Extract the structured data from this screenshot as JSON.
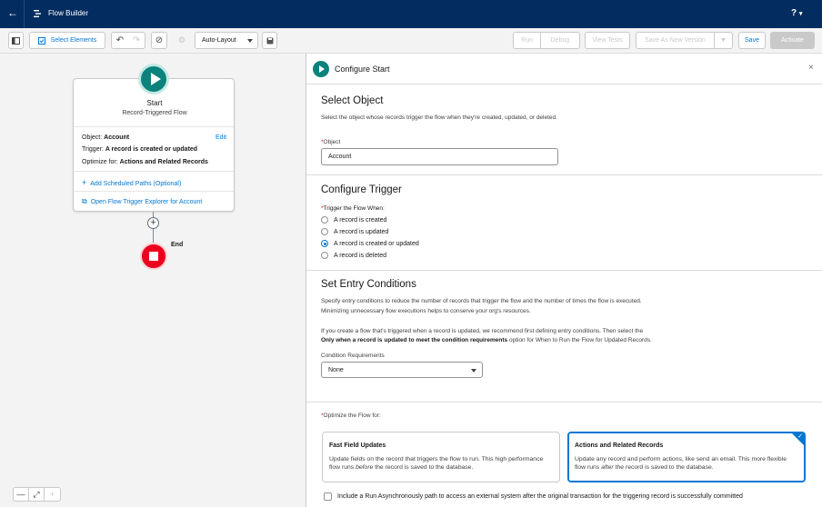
{
  "header": {
    "app_title": "Flow Builder",
    "help_label": "?",
    "back_icon": "arrow-left-icon",
    "app_icon": "flow-icon"
  },
  "toolbar": {
    "toggle_panel_icon": "panel-icon",
    "select_elements_label": "Select Elements",
    "undo_icon": "undo-icon",
    "redo_icon": "redo-icon",
    "error_icon": "prohibit-icon",
    "settings_icon": "gear-icon",
    "layout_value": "Auto-Layout",
    "save_copy_icon": "save-icon",
    "run_label": "Run",
    "debug_label": "Debug",
    "view_tests_label": "View Tests",
    "save_as_new_label": "Save As New Version",
    "save_label": "Save",
    "activate_label": "Activate"
  },
  "canvas": {
    "start_title": "Start",
    "start_subtitle": "Record-Triggered Flow",
    "object_label": "Object:",
    "object_value": "Account",
    "edit_label": "Edit",
    "trigger_label": "Trigger:",
    "trigger_value": "A record is created or updated",
    "optimize_label": "Optimize for:",
    "optimize_value": "Actions and Related Records",
    "add_paths_label": "Add Scheduled Paths (Optional)",
    "explorer_label": "Open Flow Trigger Explorer for Account",
    "end_label": "End",
    "zoom_out": "—",
    "zoom_fit": "⤢",
    "zoom_in": "+"
  },
  "panel": {
    "title": "Configure Start",
    "close_label": "×",
    "select_object": {
      "heading": "Select Object",
      "description": "Select the object whose records trigger the flow when they're created, updated, or deleted.",
      "field_label": "Object",
      "field_value": "Account"
    },
    "configure_trigger": {
      "heading": "Configure Trigger",
      "label": "Trigger the Flow When:",
      "options": [
        {
          "label": "A record is created",
          "selected": false
        },
        {
          "label": "A record is updated",
          "selected": false
        },
        {
          "label": "A record is created or updated",
          "selected": true
        },
        {
          "label": "A record is deleted",
          "selected": false
        }
      ]
    },
    "entry_conditions": {
      "heading": "Set Entry Conditions",
      "desc1_line1": "Specify entry conditions to reduce the number of records that trigger the flow and the number of times the flow is executed.",
      "desc1_line2": "Minimizing unnecessary flow executions helps to conserve your org's resources.",
      "desc2_line1": "If you create a flow that's triggered when a record is updated, we recommend first defining entry conditions. Then select the",
      "desc2_bold": "Only when a record is updated to meet the condition requirements",
      "desc2_rest": " option for When to Run the Flow for Updated Records.",
      "condition_label": "Condition Requirements",
      "condition_value": "None"
    },
    "optimize": {
      "label": "Optimize the Flow for:",
      "fast_title": "Fast Field Updates",
      "fast_desc_a": "Update fields on the record that triggers the flow to run. This high performance flow runs ",
      "fast_desc_em": "before",
      "fast_desc_b": " the record is saved to the database.",
      "actions_title": "Actions and Related Records",
      "actions_desc_a": "Update any record and perform actions, like send an email. This more flexible flow runs ",
      "actions_desc_em": "after",
      "actions_desc_b": " the record is saved to the database.",
      "selected": "actions"
    },
    "async_label": "Include a Run Asynchronously path to access an external system after the original transaction for the triggering record is successfully committed"
  }
}
